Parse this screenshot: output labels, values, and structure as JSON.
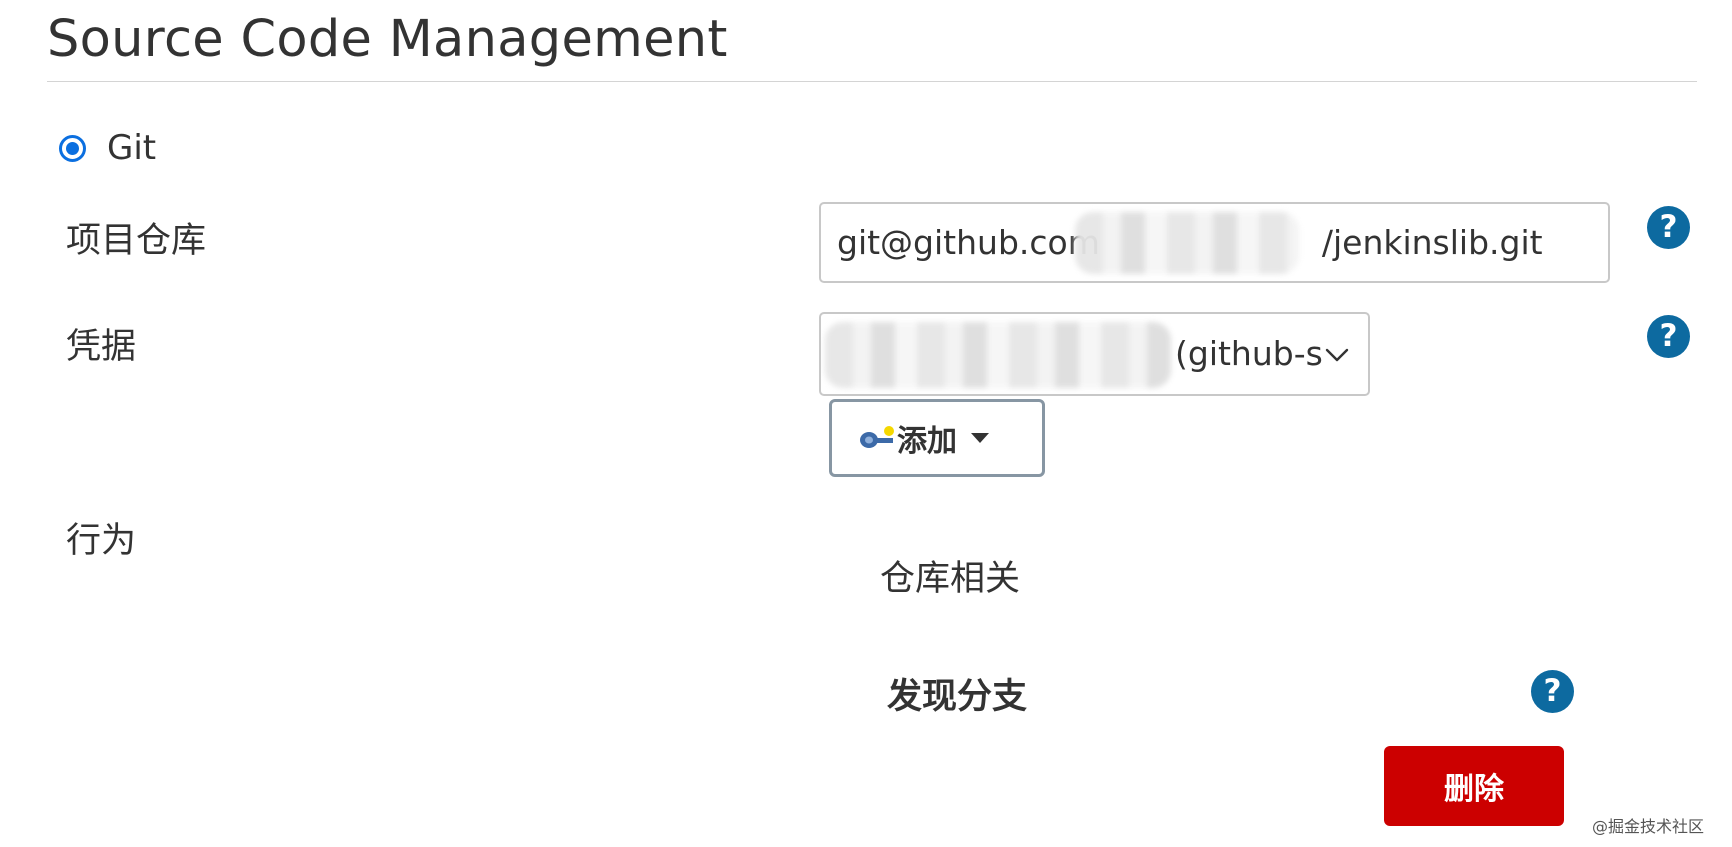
{
  "section": {
    "title": "Source Code Management"
  },
  "scm": {
    "selected_option": "Git"
  },
  "repository": {
    "label": "项目仓库",
    "url_visible_start": "git@github.com",
    "url_visible_end": "/jenkinslib.git"
  },
  "credentials": {
    "label": "凭据",
    "selected_value_visible": "(github-s",
    "add_button_label": "添加"
  },
  "behaviors": {
    "label": "行为",
    "group_heading": "仓库相关",
    "item_title": "发现分支",
    "delete_button_label": "删除"
  },
  "help": {
    "glyph": "?"
  },
  "icons": {
    "help": "question-circle-icon",
    "add": "key-icon",
    "dropdown": "chevron-down-icon",
    "add_menu": "caret-down-icon"
  },
  "colors": {
    "radio_accent": "#0b6fe0",
    "help_icon": "#0d6aa0",
    "delete_button": "#cc0000",
    "border": "#c8c8c8"
  },
  "watermark": {
    "text": "@掘金技术社区"
  }
}
